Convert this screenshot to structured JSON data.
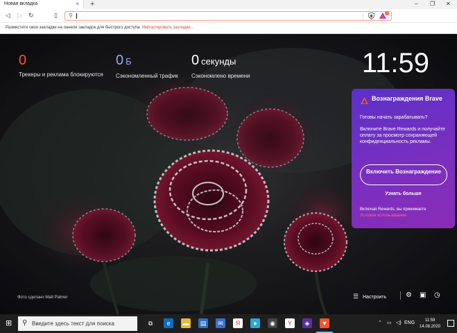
{
  "browser": {
    "tab_title": "Новая вкладка",
    "tab_close": "×",
    "new_tab": "+",
    "window_controls": {
      "minimize": "–",
      "maximize": "❐",
      "close": "✕"
    },
    "address_value": "",
    "rewards_badge": "1"
  },
  "bookmarks_bar": {
    "message": "Разместите свои закладки на панели закладок для быстрого доступа.",
    "import_link": "Импортировать закладки..."
  },
  "stats": {
    "trackers": {
      "value": "0",
      "label": "Трекеры и реклама блокируются",
      "color": "#fb542b"
    },
    "bandwidth": {
      "value": "0",
      "unit": "Б",
      "label": "Сэкономленный трафик",
      "color": "#a0a5eb"
    },
    "time": {
      "value": "0",
      "unit": "секунды",
      "label": "Сэкономлено времени",
      "color": "#ffffff"
    }
  },
  "clock": "11:59",
  "rewards": {
    "title": "Вознаграждения Brave",
    "question": "Готовы начать зарабатывать?",
    "description": "Включите Brave Rewards и получайте оплату за просмотр сохраняющей конфиденциальность рекламы.",
    "enable_button": "Включить Вознаграждение",
    "learn_more": "Узнать больше",
    "footer": "Включая Rewards, вы принимаете",
    "terms": "Условия использования."
  },
  "photo_credit": "Фото сделано Matt Palmer",
  "customize_label": "Настроить",
  "taskbar": {
    "search_placeholder": "Введите здесь текст для поиска",
    "language": "ENG",
    "time": "11:59",
    "date": "14.08.2020"
  },
  "colors": {
    "accent": "#fb542b",
    "rewards_bg": "#6a2fc4",
    "taskbar": "#1f1f1f"
  }
}
